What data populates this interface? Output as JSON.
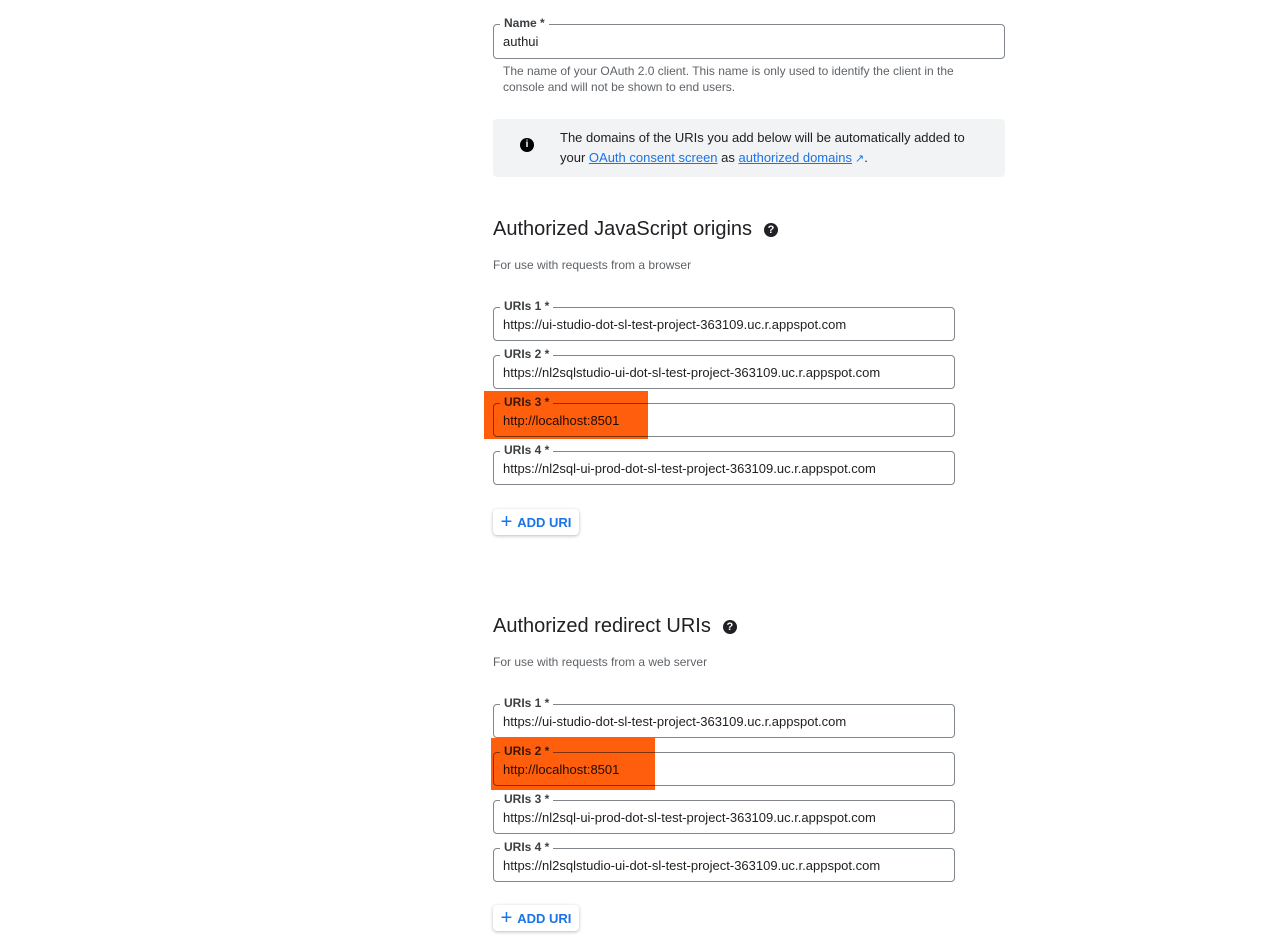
{
  "name_field": {
    "label": "Name *",
    "value": "authui",
    "hint": "The name of your OAuth 2.0 client. This name is only used to identify the client in the console and will not be shown to end users."
  },
  "info": {
    "text_before": "The domains of the URIs you add below will be automatically added to your ",
    "link1": "OAuth consent screen",
    "text_mid": " as ",
    "link2": "authorized domains",
    "text_after": "."
  },
  "js_origins": {
    "title": "Authorized JavaScript origins",
    "hint": "For use with requests from a browser",
    "uris": [
      {
        "label": "URIs 1 *",
        "value": "https://ui-studio-dot-sl-test-project-363109.uc.r.appspot.com"
      },
      {
        "label": "URIs 2 *",
        "value": "https://nl2sqlstudio-ui-dot-sl-test-project-363109.uc.r.appspot.com"
      },
      {
        "label": "URIs 3 *",
        "value": "http://localhost:8501"
      },
      {
        "label": "URIs 4 *",
        "value": "https://nl2sql-ui-prod-dot-sl-test-project-363109.uc.r.appspot.com"
      }
    ],
    "add_label": "ADD URI"
  },
  "redirect_uris": {
    "title": "Authorized redirect URIs",
    "hint": "For use with requests from a web server",
    "uris": [
      {
        "label": "URIs 1 *",
        "value": "https://ui-studio-dot-sl-test-project-363109.uc.r.appspot.com"
      },
      {
        "label": "URIs 2 *",
        "value": "http://localhost:8501"
      },
      {
        "label": "URIs 3 *",
        "value": "https://nl2sql-ui-prod-dot-sl-test-project-363109.uc.r.appspot.com"
      },
      {
        "label": "URIs 4 *",
        "value": "https://nl2sqlstudio-ui-dot-sl-test-project-363109.uc.r.appspot.com"
      }
    ],
    "add_label": "ADD URI"
  },
  "highlight_color": "#ff5500"
}
